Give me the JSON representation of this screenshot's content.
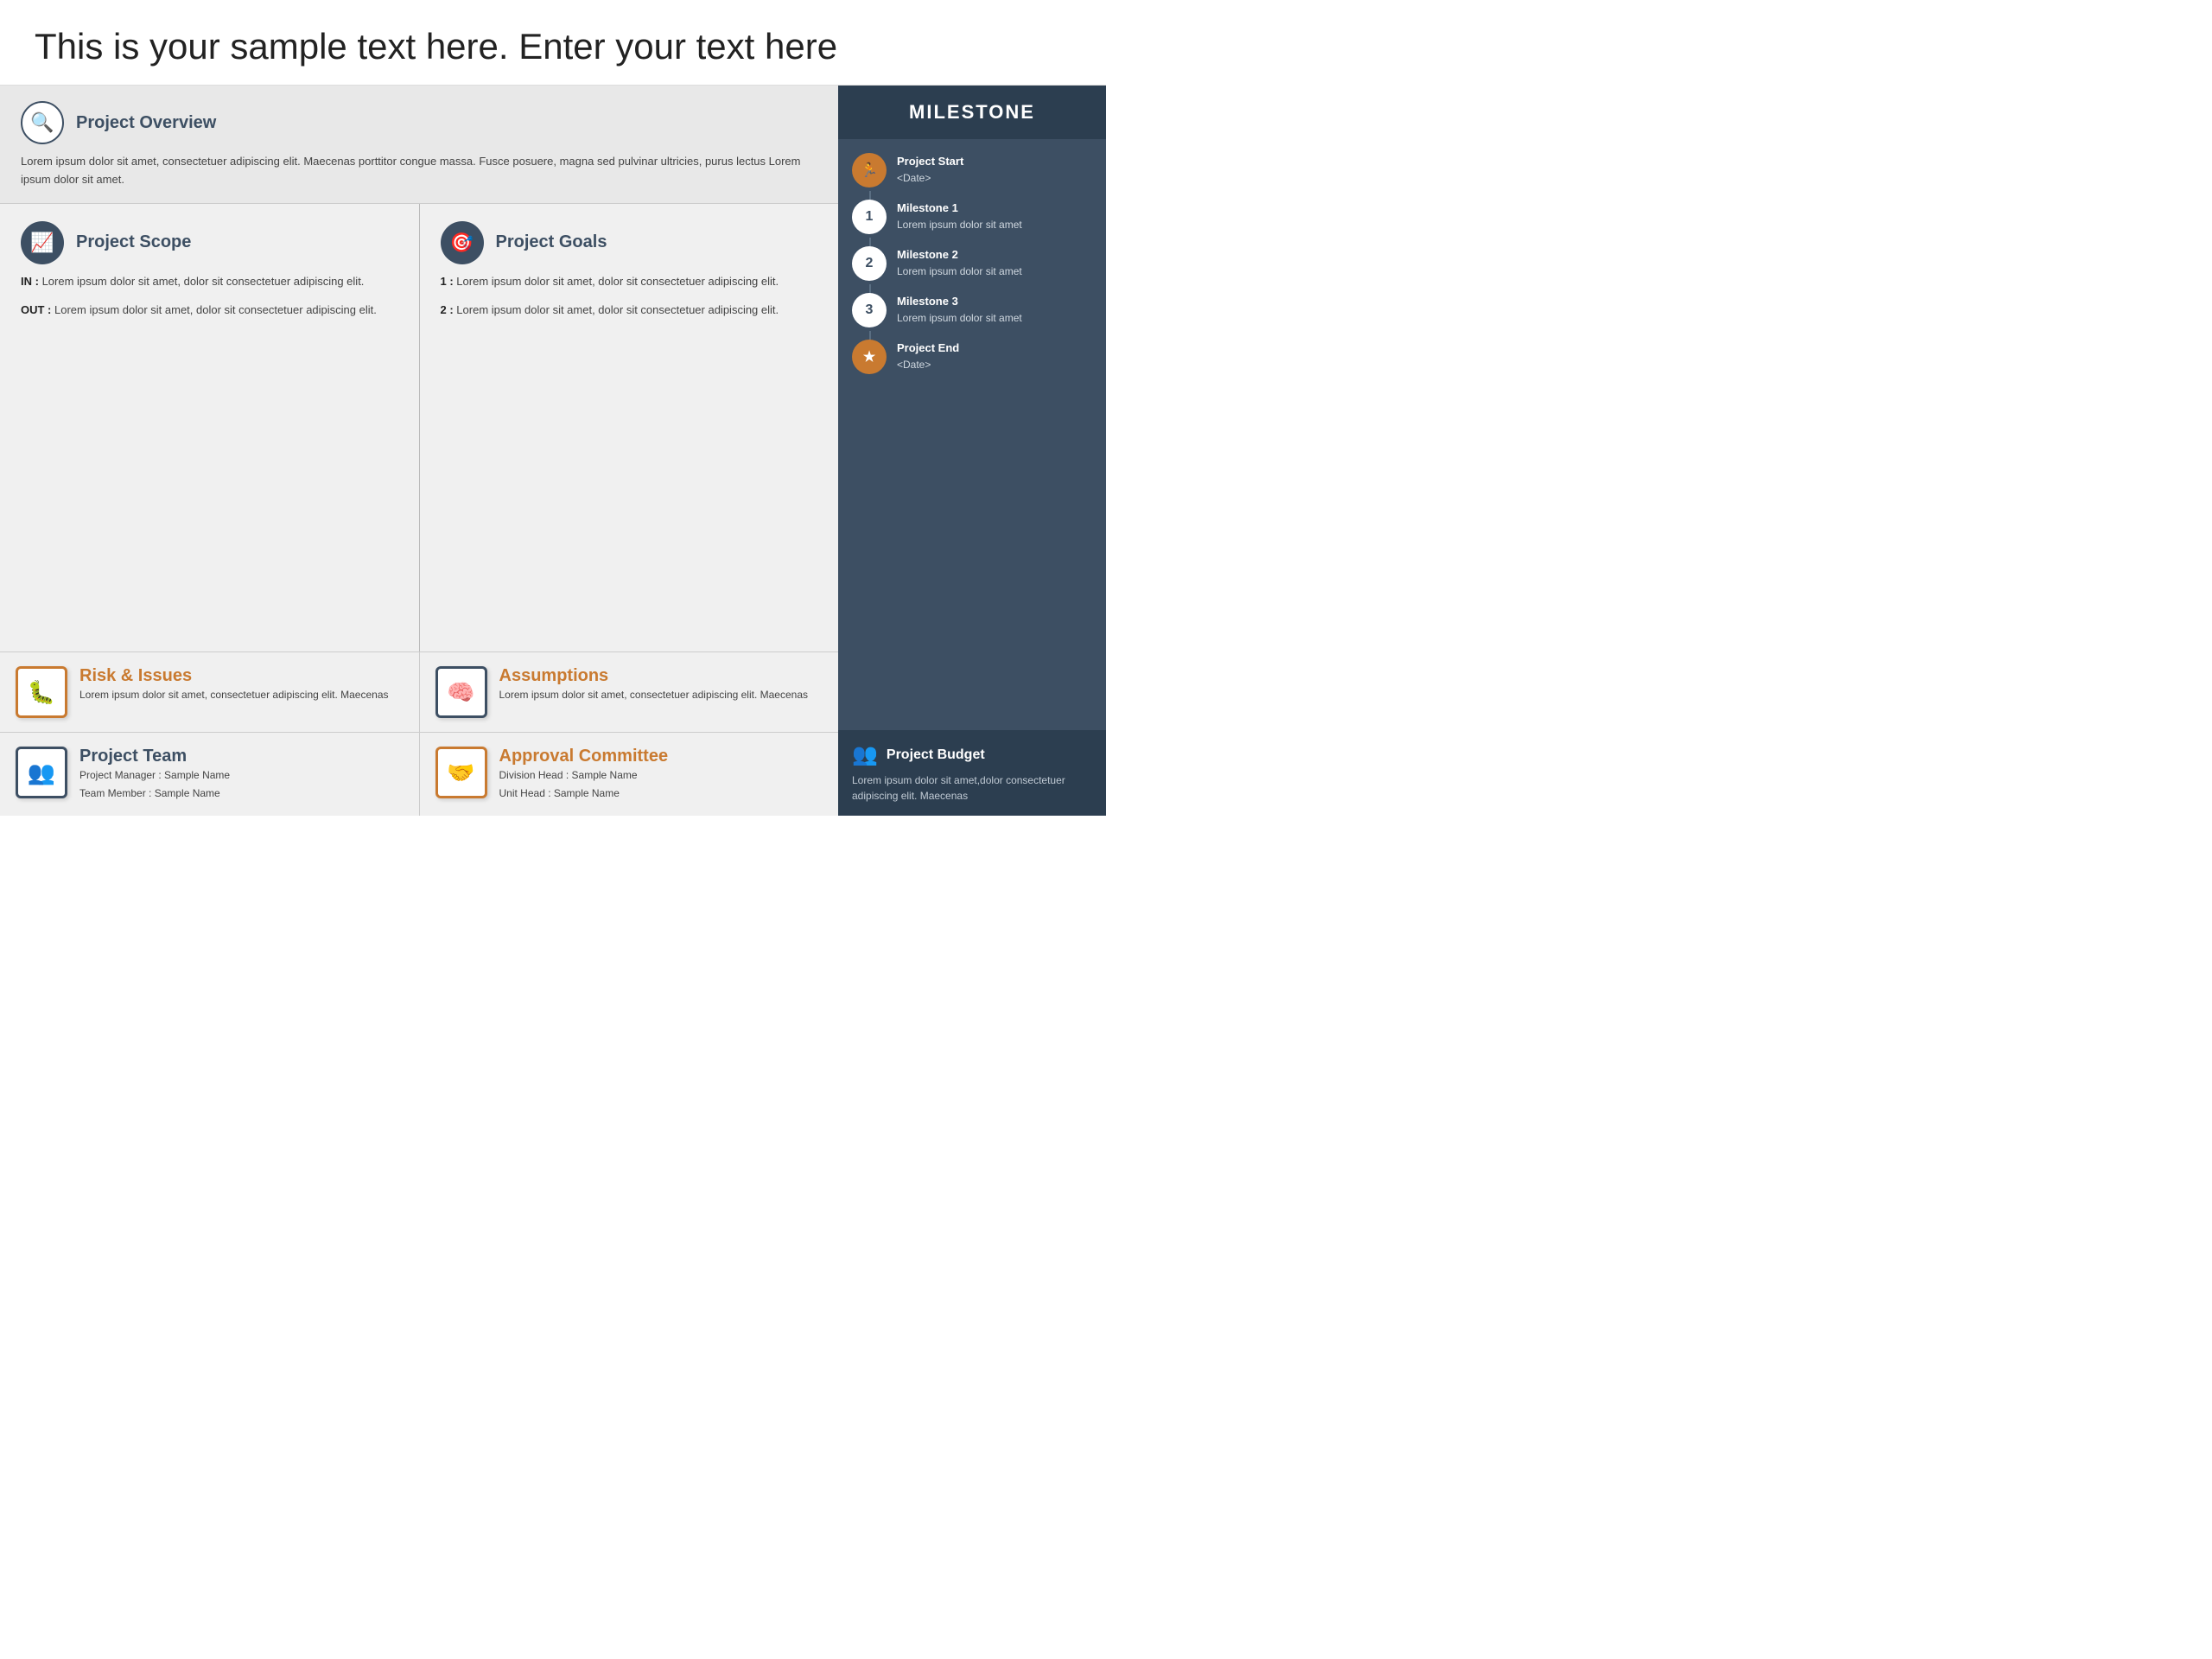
{
  "page": {
    "title": "This is your sample text here. Enter your text here"
  },
  "overview": {
    "section_title": "Project Overview",
    "text": "Lorem ipsum dolor sit amet, consectetuer adipiscing elit. Maecenas porttitor congue massa. Fusce posuere, magna sed pulvinar ultricies, purus lectus Lorem ipsum dolor sit amet."
  },
  "scope": {
    "section_title": "Project Scope",
    "in_label": "IN :",
    "in_text": "Lorem ipsum dolor sit amet, dolor sit consectetuer adipiscing elit.",
    "out_label": "OUT :",
    "out_text": "Lorem ipsum dolor sit amet, dolor sit consectetuer adipiscing elit."
  },
  "goals": {
    "section_title": "Project Goals",
    "item1_label": "1 :",
    "item1_text": "Lorem ipsum dolor sit amet, dolor sit consectetuer adipiscing elit.",
    "item2_label": "2 :",
    "item2_text": "Lorem ipsum dolor sit amet, dolor sit consectetuer adipiscing elit."
  },
  "risk": {
    "section_title": "Risk & Issues",
    "text": "Lorem ipsum dolor sit amet, consectetuer adipiscing elit. Maecenas"
  },
  "assumptions": {
    "section_title": "Assumptions",
    "text": "Lorem ipsum dolor sit amet, consectetuer adipiscing elit. Maecenas"
  },
  "team": {
    "section_title": "Project Team",
    "manager_label": "Project Manager : Sample Name",
    "member_label": "Team Member : Sample Name"
  },
  "approval": {
    "section_title": "Approval Committee",
    "division_label": "Division Head : Sample Name",
    "unit_label": "Unit Head : Sample Name"
  },
  "milestone": {
    "header": "MILESTONE",
    "items": [
      {
        "label": "Project Start",
        "sub": "<Date>",
        "type": "orange",
        "icon": "🏃"
      },
      {
        "label": "Milestone 1",
        "sub": "Lorem ipsum dolor sit amet",
        "type": "outline",
        "icon": "1"
      },
      {
        "label": "Milestone 2",
        "sub": "Lorem ipsum dolor sit amet",
        "type": "outline",
        "icon": "2"
      },
      {
        "label": "Milestone 3",
        "sub": "Lorem ipsum dolor sit amet",
        "type": "outline",
        "icon": "3"
      },
      {
        "label": "Project End",
        "sub": "<Date>",
        "type": "orange",
        "icon": "★"
      }
    ]
  },
  "budget": {
    "title": "Project Budget",
    "text": "Lorem ipsum dolor sit amet,dolor consectetuer adipiscing elit. Maecenas"
  },
  "colors": {
    "dark_blue": "#3d4f63",
    "orange": "#c97a30",
    "light_bg": "#f0f0f0"
  }
}
